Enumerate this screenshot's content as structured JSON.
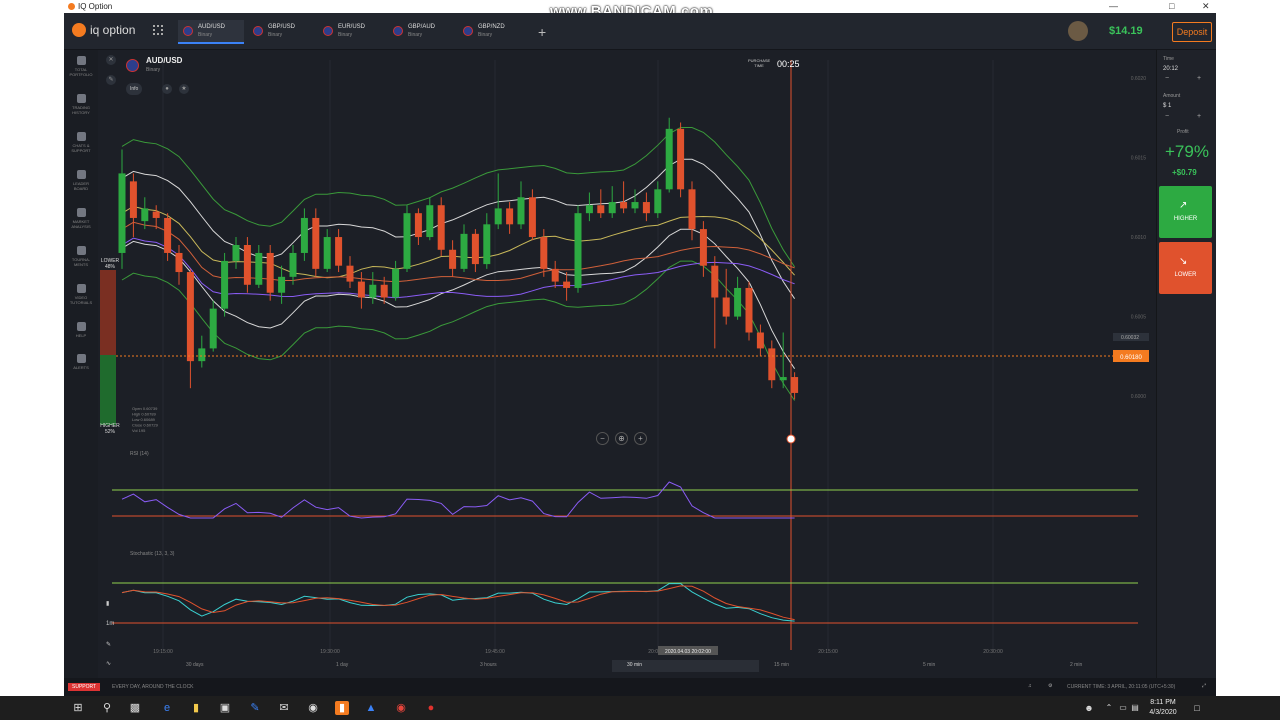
{
  "window": {
    "title": "IQ Option",
    "watermark": "www.BANDICAM.com"
  },
  "topbar": {
    "logo": "iq option",
    "tabs": [
      {
        "pair": "AUD/USD",
        "type": "Binary"
      },
      {
        "pair": "GBP/USD",
        "type": "Binary"
      },
      {
        "pair": "EUR/USD",
        "type": "Binary"
      },
      {
        "pair": "GBP/AUD",
        "type": "Binary"
      },
      {
        "pair": "GBP/NZD",
        "type": "Binary"
      }
    ],
    "balance": "$14.19",
    "deposit": "Deposit"
  },
  "leftnav": [
    {
      "label": "TOTAL PORTFOLIO",
      "icon": "briefcase-icon"
    },
    {
      "label": "TRADING HISTORY",
      "icon": "history-icon"
    },
    {
      "label": "CHATS & SUPPORT",
      "icon": "chat-icon"
    },
    {
      "label": "LEADER BOARD",
      "icon": "leaderboard-icon"
    },
    {
      "label": "MARKET ANALYSIS",
      "icon": "analysis-icon"
    },
    {
      "label": "TOURNA-MENTS",
      "icon": "trophy-icon"
    },
    {
      "label": "VIDEO TUTORIALS",
      "icon": "play-icon"
    },
    {
      "label": "HELP",
      "icon": "help-icon"
    },
    {
      "label": "ALERTS",
      "icon": "bell-icon"
    }
  ],
  "chart": {
    "asset": "AUD/USD",
    "asset_type": "Binary",
    "info_label": "Info",
    "purchase_time_label": "PURCHASE TIME",
    "countdown": "00:25",
    "lower_label": "LOWER",
    "lower_pct": "48%",
    "higher_label": "HIGHER",
    "higher_pct": "52%",
    "ohlc": [
      "Open 0.60739",
      "High 0.60789",
      "Low 0.60689",
      "Close 0.60729",
      "Vol 195"
    ],
    "price_tag": "0.60180",
    "price_tag2": "0.60032",
    "rsi_label": "RSI (14)",
    "stoch_label": "Stochastic (13, 3, 3)",
    "x_ticks": [
      "19:15:00",
      "19:30:00",
      "19:45:00",
      "20:00:00",
      "20:15:00",
      "20:30:00"
    ],
    "y_ticks": [
      "0.6020",
      "0.6015",
      "0.6010",
      "0.6005",
      "0.6000"
    ],
    "crosshair_time": "2020.04.03 20:02:00",
    "timeframes": [
      "30 days",
      "1 day",
      "3 hours",
      "30 min",
      "15 min",
      "5 min",
      "2 min"
    ],
    "candle_interval": "1m"
  },
  "chart_data": {
    "type": "candlestick",
    "candles": [
      {
        "o": 0.6009,
        "c": 0.6014,
        "h": 0.60155,
        "l": 0.6008
      },
      {
        "o": 0.60135,
        "c": 0.60112,
        "h": 0.6014,
        "l": 0.601
      },
      {
        "o": 0.6011,
        "c": 0.60118,
        "h": 0.60125,
        "l": 0.60105
      },
      {
        "o": 0.60116,
        "c": 0.60112,
        "h": 0.6012,
        "l": 0.60105
      },
      {
        "o": 0.60112,
        "c": 0.6009,
        "h": 0.60115,
        "l": 0.60085
      },
      {
        "o": 0.6009,
        "c": 0.60078,
        "h": 0.60095,
        "l": 0.6007
      },
      {
        "o": 0.60078,
        "c": 0.60022,
        "h": 0.6008,
        "l": 0.60005
      },
      {
        "o": 0.60022,
        "c": 0.6003,
        "h": 0.60038,
        "l": 0.60018
      },
      {
        "o": 0.6003,
        "c": 0.60055,
        "h": 0.6006,
        "l": 0.60028
      },
      {
        "o": 0.60055,
        "c": 0.60085,
        "h": 0.6009,
        "l": 0.6005
      },
      {
        "o": 0.60085,
        "c": 0.60095,
        "h": 0.601,
        "l": 0.6008
      },
      {
        "o": 0.60095,
        "c": 0.6007,
        "h": 0.601,
        "l": 0.60065
      },
      {
        "o": 0.6007,
        "c": 0.6009,
        "h": 0.60095,
        "l": 0.60068
      },
      {
        "o": 0.6009,
        "c": 0.60065,
        "h": 0.60095,
        "l": 0.6006
      },
      {
        "o": 0.60065,
        "c": 0.60075,
        "h": 0.60082,
        "l": 0.60058
      },
      {
        "o": 0.60075,
        "c": 0.6009,
        "h": 0.60095,
        "l": 0.6007
      },
      {
        "o": 0.6009,
        "c": 0.60112,
        "h": 0.60118,
        "l": 0.60085
      },
      {
        "o": 0.60112,
        "c": 0.6008,
        "h": 0.60118,
        "l": 0.60075
      },
      {
        "o": 0.6008,
        "c": 0.601,
        "h": 0.60105,
        "l": 0.60078
      },
      {
        "o": 0.601,
        "c": 0.60082,
        "h": 0.60105,
        "l": 0.60078
      },
      {
        "o": 0.60082,
        "c": 0.60072,
        "h": 0.60088,
        "l": 0.60068
      },
      {
        "o": 0.60072,
        "c": 0.60062,
        "h": 0.60078,
        "l": 0.60055
      },
      {
        "o": 0.60062,
        "c": 0.6007,
        "h": 0.60078,
        "l": 0.60058
      },
      {
        "o": 0.6007,
        "c": 0.60062,
        "h": 0.60075,
        "l": 0.60058
      },
      {
        "o": 0.60062,
        "c": 0.6008,
        "h": 0.60085,
        "l": 0.6006
      },
      {
        "o": 0.6008,
        "c": 0.60115,
        "h": 0.6012,
        "l": 0.60078
      },
      {
        "o": 0.60115,
        "c": 0.601,
        "h": 0.60118,
        "l": 0.60095
      },
      {
        "o": 0.601,
        "c": 0.6012,
        "h": 0.60125,
        "l": 0.60098
      },
      {
        "o": 0.6012,
        "c": 0.60092,
        "h": 0.60125,
        "l": 0.60088
      },
      {
        "o": 0.60092,
        "c": 0.6008,
        "h": 0.60098,
        "l": 0.60075
      },
      {
        "o": 0.6008,
        "c": 0.60102,
        "h": 0.60108,
        "l": 0.60078
      },
      {
        "o": 0.60102,
        "c": 0.60083,
        "h": 0.60105,
        "l": 0.60078
      },
      {
        "o": 0.60083,
        "c": 0.60108,
        "h": 0.60115,
        "l": 0.6008
      },
      {
        "o": 0.60108,
        "c": 0.60118,
        "h": 0.6014,
        "l": 0.60105
      },
      {
        "o": 0.60118,
        "c": 0.60108,
        "h": 0.60122,
        "l": 0.60102
      },
      {
        "o": 0.60108,
        "c": 0.60125,
        "h": 0.60135,
        "l": 0.60105
      },
      {
        "o": 0.60125,
        "c": 0.601,
        "h": 0.6013,
        "l": 0.60098
      },
      {
        "o": 0.601,
        "c": 0.6008,
        "h": 0.60105,
        "l": 0.60075
      },
      {
        "o": 0.6008,
        "c": 0.60072,
        "h": 0.60085,
        "l": 0.60068
      },
      {
        "o": 0.60072,
        "c": 0.60068,
        "h": 0.60078,
        "l": 0.6006
      },
      {
        "o": 0.60068,
        "c": 0.60115,
        "h": 0.6012,
        "l": 0.60065
      },
      {
        "o": 0.60115,
        "c": 0.6012,
        "h": 0.60128,
        "l": 0.6011
      },
      {
        "o": 0.6012,
        "c": 0.60115,
        "h": 0.6013,
        "l": 0.60112
      },
      {
        "o": 0.60115,
        "c": 0.60122,
        "h": 0.60132,
        "l": 0.60112
      },
      {
        "o": 0.60122,
        "c": 0.60118,
        "h": 0.60135,
        "l": 0.60115
      },
      {
        "o": 0.60118,
        "c": 0.60122,
        "h": 0.6013,
        "l": 0.60115
      },
      {
        "o": 0.60122,
        "c": 0.60115,
        "h": 0.60128,
        "l": 0.6011
      },
      {
        "o": 0.60115,
        "c": 0.6013,
        "h": 0.60135,
        "l": 0.60112
      },
      {
        "o": 0.6013,
        "c": 0.60168,
        "h": 0.60175,
        "l": 0.60128
      },
      {
        "o": 0.60168,
        "c": 0.6013,
        "h": 0.60172,
        "l": 0.60125
      },
      {
        "o": 0.6013,
        "c": 0.60105,
        "h": 0.60135,
        "l": 0.60098
      },
      {
        "o": 0.60105,
        "c": 0.60082,
        "h": 0.6011,
        "l": 0.60075
      },
      {
        "o": 0.60082,
        "c": 0.60062,
        "h": 0.60088,
        "l": 0.6003
      },
      {
        "o": 0.60062,
        "c": 0.6005,
        "h": 0.6008,
        "l": 0.60045
      },
      {
        "o": 0.6005,
        "c": 0.60068,
        "h": 0.60075,
        "l": 0.60048
      },
      {
        "o": 0.60068,
        "c": 0.6004,
        "h": 0.60072,
        "l": 0.60035
      },
      {
        "o": 0.6004,
        "c": 0.6003,
        "h": 0.60045,
        "l": 0.60025
      },
      {
        "o": 0.6003,
        "c": 0.6001,
        "h": 0.60035,
        "l": 0.60005
      },
      {
        "o": 0.6001,
        "c": 0.60012,
        "h": 0.6004,
        "l": 0.60005
      },
      {
        "o": 0.60012,
        "c": 0.60002,
        "h": 0.60015,
        "l": 0.59998
      }
    ],
    "ylim": [
      0.59985,
      0.60205
    ]
  },
  "rightpanel": {
    "time_label": "Time",
    "time_value": "20:12",
    "amount_label": "Amount",
    "amount_value": "$ 1",
    "profit_label": "Profit",
    "profit_pct": "+79%",
    "profit_amount": "+$0.79",
    "higher": "HIGHER",
    "lower": "LOWER"
  },
  "statusbar": {
    "support": "SUPPORT",
    "tagline": "EVERY DAY, AROUND THE CLOCK",
    "current_time": "CURRENT TIME: 3 APRIL, 20:11:05 (UTC+5:30)"
  },
  "taskbar": {
    "time": "8:11 PM",
    "date": "4/3/2020"
  },
  "colors": {
    "up": "#2daa42",
    "down": "#e0522d",
    "accent": "#f47b20"
  }
}
